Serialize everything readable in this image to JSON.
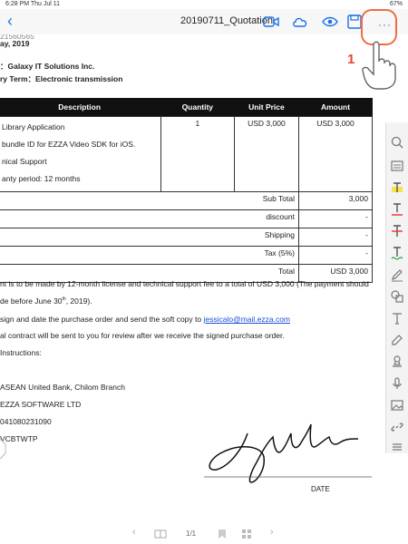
{
  "status_bar": {
    "time": "6:28 PM   Thu Jul 11",
    "battery": "67%"
  },
  "toolbar": {
    "back_glyph": "‹",
    "title": "20190711_Quotation",
    "more_glyph": "···"
  },
  "annotation": {
    "step": "1"
  },
  "doc": {
    "top_fragment": "21560565",
    "date": "ay, 2019",
    "to": "：Galaxy IT Solutions Inc.",
    "delivery": "ry Term：Electronic transmission",
    "headers": {
      "description": "Description",
      "quantity": "Quantity",
      "unit_price": "Unit Price",
      "amount": "Amount"
    },
    "item": {
      "lines": [
        "Library Application",
        "bundle ID for EZZA Video SDK for iOS.",
        "nical Support",
        "anty period: 12 months"
      ],
      "quantity": "1",
      "unit_price": "USD 3,000",
      "amount": "USD 3,000"
    },
    "totals": [
      {
        "label": "Sub  Total",
        "value": "3,000"
      },
      {
        "label": "discount",
        "value": "-"
      },
      {
        "label": "Shipping",
        "value": "-"
      },
      {
        "label": "Tax (5%)",
        "value": "-"
      },
      {
        "label": "Total",
        "value": "USD  3,000"
      }
    ],
    "note1": "nt is to be made by 12-month license and technical support fee to a total of USD 3,000 (The payment should",
    "note2a": "de before June 30",
    "note2sup": "th",
    "note2b": ", 2019).",
    "note3a": "sign and date the purchase order and send the soft copy to ",
    "email": "jessicalo@mail.ezza.com",
    "note4": "al contract will be sent to you for review after we receive the signed purchase order.",
    "instr": "Instructions:",
    "bank": "ASEAN United Bank, Chilom Branch",
    "acct_name": "EZZA SOFTWARE LTD",
    "acct_no": "041080231090",
    "swift": "VCBTWTP",
    "date_label": "DATE"
  },
  "bottom_bar": {
    "page": "1/1"
  }
}
